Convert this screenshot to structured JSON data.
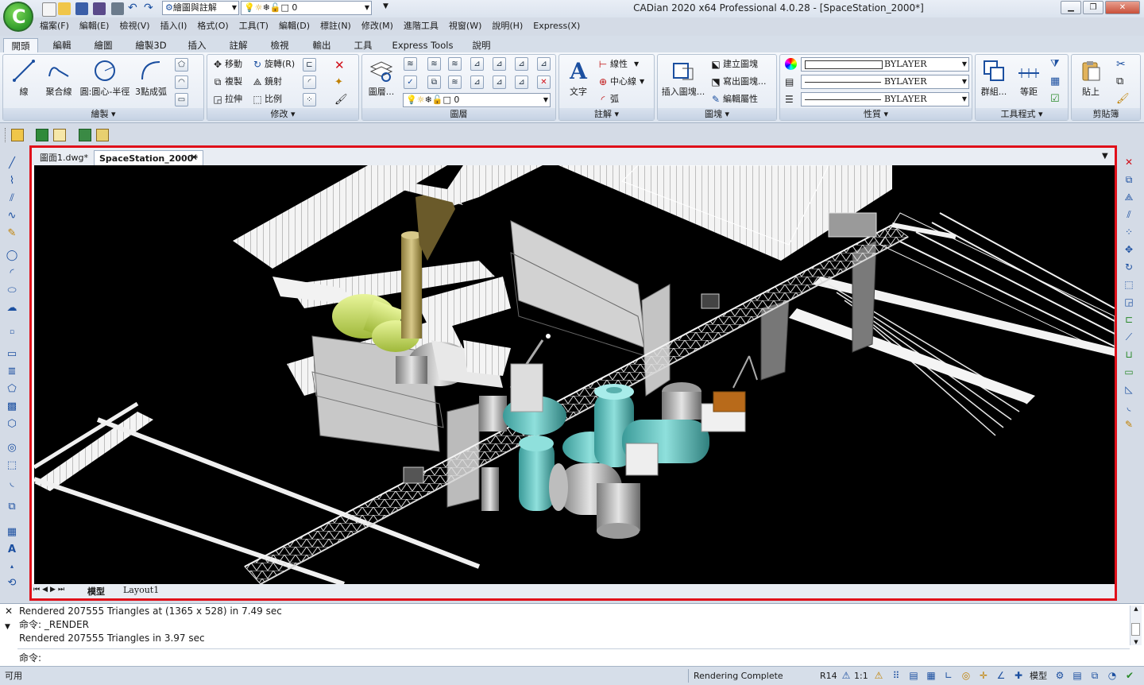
{
  "app": {
    "title": "CADian 2020 x64 Professional 4.0.28 - [SpaceStation_2000*]",
    "workspace": "繪圖與註解",
    "layer_combo": "0"
  },
  "menu": [
    "檔案(F)",
    "編輯(E)",
    "檢視(V)",
    "插入(I)",
    "格式(O)",
    "工具(T)",
    "編輯(D)",
    "標註(N)",
    "修改(M)",
    "進階工具",
    "視窗(W)",
    "說明(H)",
    "Express(X)"
  ],
  "ribbon_tabs": [
    "開頭",
    "編輯",
    "繪圖",
    "繪製3D",
    "插入",
    "註解",
    "檢視",
    "輸出",
    "工具",
    "Express Tools",
    "說明"
  ],
  "ribbon": {
    "draw": {
      "title": "繪製 ▾",
      "line": "線",
      "polyline": "聚合線",
      "circle": "圓:圓心-半徑",
      "arc": "3點成弧"
    },
    "modify": {
      "title": "修改 ▾",
      "move": "移動",
      "rotate": "旋轉(R)",
      "copy": "複製",
      "mirror": "鏡射",
      "stretch": "拉伸",
      "scale": "比例"
    },
    "layer": {
      "title": "圖層",
      "props": "圖層...",
      "current": "0"
    },
    "annotate": {
      "title": "註解 ▾",
      "text": "文字",
      "linear": "線性",
      "centerline": "中心線",
      "arc": "弧"
    },
    "block": {
      "title": "圖塊 ▾",
      "insert": "插入圖塊...",
      "create": "建立圖塊",
      "write": "寫出圖塊...",
      "edit": "編輯屬性"
    },
    "properties": {
      "title": "性質 ▾",
      "color": "BYLAYER",
      "linetype": "BYLAYER",
      "lineweight": "BYLAYER"
    },
    "tools": {
      "title": "工具程式 ▾",
      "group": "群組...",
      "measure": "等距"
    },
    "clipboard": {
      "title": "剪貼簿",
      "paste": "貼上"
    }
  },
  "doc_tabs": [
    {
      "label": "圖面1.dwg*",
      "active": false
    },
    {
      "label": "SpaceStation_2000*",
      "active": true
    }
  ],
  "layout_tabs": [
    "模型",
    "Layout1"
  ],
  "command_history": [
    "Rendered 207555 Triangles at (1365 x 528) in 7.49 sec",
    "命令: _RENDER",
    "Rendered 207555 Triangles in 3.97 sec"
  ],
  "command_prompt": "命令:",
  "status": {
    "left": "可用",
    "message": "Rendering Complete",
    "version": "R14",
    "scale": "1:1",
    "space": "模型"
  },
  "colors": {
    "highlight": "#e0101a",
    "canvas": "#000000",
    "ribbon": "#dde5f0"
  }
}
